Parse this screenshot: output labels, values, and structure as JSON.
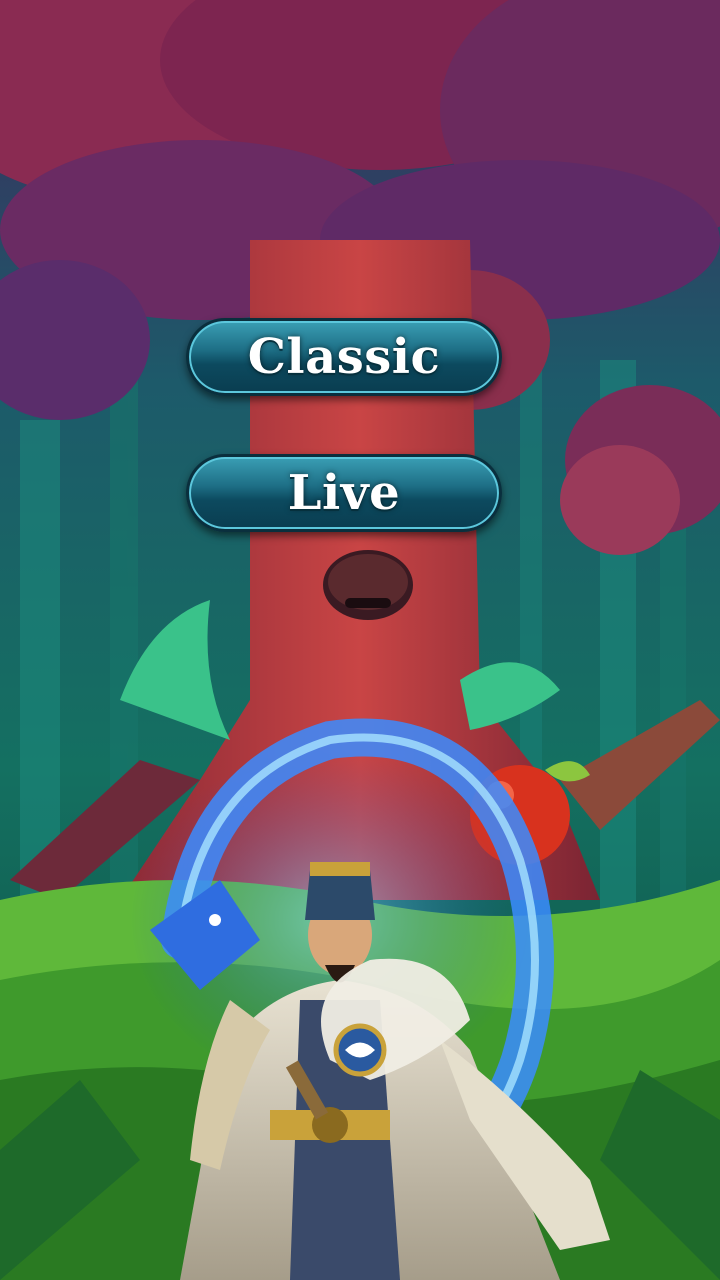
{
  "menu": {
    "classic_label": "Classic",
    "live_label": "Live"
  },
  "theme": {
    "button_top": "#3a9fb5",
    "button_bottom": "#0a3d50",
    "button_rim": "#5cc7dc"
  }
}
